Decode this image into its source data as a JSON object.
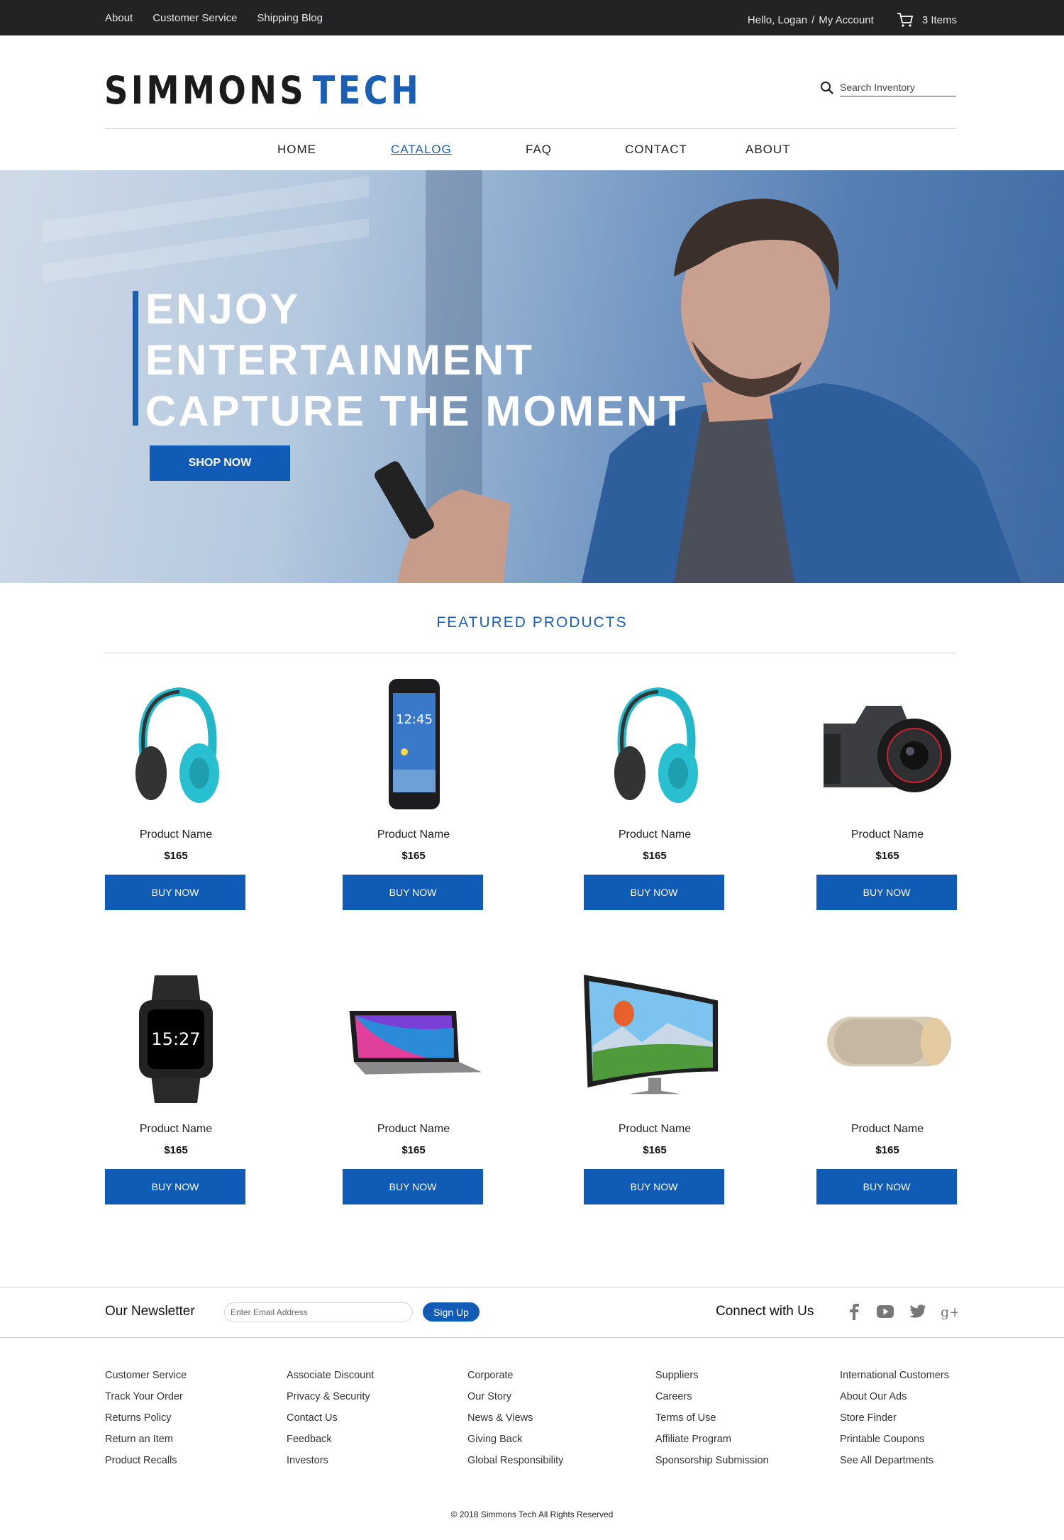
{
  "topbar": {
    "links": [
      "About",
      "Customer Service",
      "Shipping Blog"
    ],
    "greeting": "Hello, Logan",
    "account": "My Account",
    "cart_count": "3 Items"
  },
  "header": {
    "logo_part1": "SIMMONS",
    "logo_part2": "TECH",
    "search_placeholder": "Search Inventory"
  },
  "nav": {
    "items": [
      "HOME",
      "CATALOG",
      "FAQ",
      "CONTACT",
      "ABOUT"
    ],
    "active": "CATALOG"
  },
  "hero": {
    "lines": [
      "ENJOY",
      "ENTERTAINMENT",
      "CAPTURE THE MOMENT"
    ],
    "cta": "SHOP NOW"
  },
  "featured": {
    "title": "FEATURED PRODUCTS",
    "products": [
      {
        "name": "Product Name",
        "price": "$165",
        "button": "BUY NOW",
        "icon": "headphones-icon"
      },
      {
        "name": "Product Name",
        "price": "$165",
        "button": "BUY NOW",
        "icon": "smartphone-icon"
      },
      {
        "name": "Product Name",
        "price": "$165",
        "button": "BUY NOW",
        "icon": "headphones-icon"
      },
      {
        "name": "Product Name",
        "price": "$165",
        "button": "BUY NOW",
        "icon": "camera-icon"
      },
      {
        "name": "Product Name",
        "price": "$165",
        "button": "BUY NOW",
        "icon": "smartwatch-icon"
      },
      {
        "name": "Product Name",
        "price": "$165",
        "button": "BUY NOW",
        "icon": "laptop-icon"
      },
      {
        "name": "Product Name",
        "price": "$165",
        "button": "BUY NOW",
        "icon": "curved-tv-icon"
      },
      {
        "name": "Product Name",
        "price": "$165",
        "button": "BUY NOW",
        "icon": "speaker-icon"
      }
    ],
    "phone_time": "12:45",
    "watch_time": "15:27"
  },
  "newsletter": {
    "title": "Our Newsletter",
    "placeholder": "Enter Email Address",
    "button": "Sign Up",
    "connect": "Connect with Us",
    "social_icons": [
      "facebook-icon",
      "youtube-icon",
      "twitter-icon",
      "google-plus-icon"
    ]
  },
  "footer": {
    "columns": [
      [
        "Customer Service",
        "Track Your Order",
        "Returns Policy",
        "Return an Item",
        "Product Recalls"
      ],
      [
        "Associate Discount",
        "Privacy & Security",
        "Contact Us",
        "Feedback",
        "Investors"
      ],
      [
        "Corporate",
        "Our Story",
        "News & Views",
        "Giving Back",
        "Global Responsibility"
      ],
      [
        "Suppliers",
        "Careers",
        "Terms of Use",
        "Affiliate Program",
        "Sponsorship Submission"
      ],
      [
        "International Customers",
        "About Our Ads",
        "Store Finder",
        "Printable Coupons",
        "See All Departments"
      ]
    ],
    "copyright": "© 2018 Simmons Tech All Rights Reserved"
  },
  "colors": {
    "accent": "#1a5fb4",
    "topbar": "#232325",
    "button": "#0f5bb5"
  }
}
